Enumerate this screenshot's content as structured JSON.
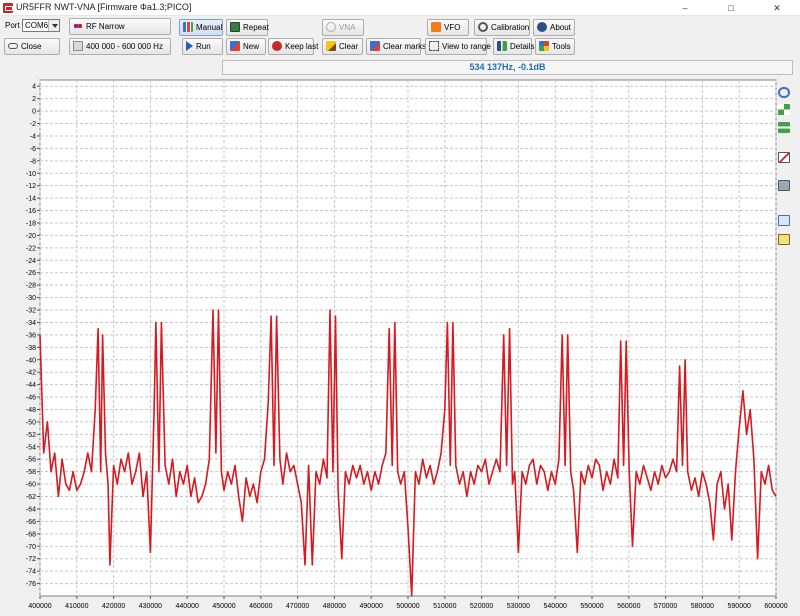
{
  "window": {
    "title": "UR5FFR NWT-VNA [Firmware Фа1.3;PICO]",
    "minimize": "–",
    "maximize": "□",
    "close": "✕"
  },
  "toolbar": {
    "port_label": "Port",
    "port_value": "COM6",
    "close_label": "Close",
    "mode_label": "RF Narrow",
    "range_label": "400 000 - 600 000 Hz",
    "manual_label": "Manual",
    "repeat_label": "Repeat",
    "run_label": "Run",
    "new_label": "New",
    "keep_last_label": "Keep last",
    "clear_label": "Clear",
    "clear_marks_label": "Clear marks",
    "vna_label": "VNA",
    "view_to_range_label": "View to range",
    "vfo_label": "VFO",
    "calibration_label": "Calibration",
    "about_label": "About",
    "details_label": "Details",
    "tools_label": "Tools"
  },
  "status": {
    "readout": "534 137Hz, -0.1dB"
  },
  "side_tools": [
    "zoom-icon",
    "fit-icon",
    "vertical-scale-icon",
    "chart-settings-icon",
    "display-icon",
    "copy-icon",
    "export-icon"
  ],
  "colors": {
    "trace": "#d71920",
    "grid": "#c8c8c8",
    "readout": "#1f6fb0"
  },
  "chart_data": {
    "type": "line",
    "title": "",
    "xlabel": "",
    "ylabel": "",
    "xlim": [
      400000,
      600000
    ],
    "ylim": [
      -78,
      5
    ],
    "x_ticks": [
      400000,
      410000,
      420000,
      430000,
      440000,
      450000,
      460000,
      470000,
      480000,
      490000,
      500000,
      510000,
      520000,
      530000,
      540000,
      550000,
      560000,
      570000,
      580000,
      590000,
      600000
    ],
    "y_ticks": [
      4,
      2,
      0,
      -2,
      -4,
      -6,
      -8,
      -10,
      -12,
      -14,
      -16,
      -18,
      -20,
      -22,
      -24,
      -26,
      -28,
      -30,
      -32,
      -34,
      -36,
      -38,
      -40,
      -42,
      -44,
      -46,
      -48,
      -50,
      -52,
      -54,
      -56,
      -58,
      -60,
      -62,
      -64,
      -66,
      -68,
      -70,
      -72,
      -74,
      -76
    ],
    "grid": true,
    "series": [
      {
        "values": [
          [
            400000,
            -36
          ],
          [
            401000,
            -55
          ],
          [
            402000,
            -50
          ],
          [
            403000,
            -58
          ],
          [
            404000,
            -55
          ],
          [
            405000,
            -62
          ],
          [
            406000,
            -56
          ],
          [
            407000,
            -60
          ],
          [
            408000,
            -61
          ],
          [
            409000,
            -58
          ],
          [
            410000,
            -61
          ],
          [
            411000,
            -60
          ],
          [
            412000,
            -58
          ],
          [
            413000,
            -55
          ],
          [
            414000,
            -58
          ],
          [
            415000,
            -48
          ],
          [
            415800,
            -35
          ],
          [
            416500,
            -58
          ],
          [
            417000,
            -36
          ],
          [
            417800,
            -55
          ],
          [
            418500,
            -60
          ],
          [
            419000,
            -73
          ],
          [
            420000,
            -57
          ],
          [
            421000,
            -60
          ],
          [
            422000,
            -56
          ],
          [
            423000,
            -58
          ],
          [
            424000,
            -55
          ],
          [
            425000,
            -60
          ],
          [
            426000,
            -58
          ],
          [
            427000,
            -55
          ],
          [
            428000,
            -62
          ],
          [
            429000,
            -58
          ],
          [
            430000,
            -71
          ],
          [
            431000,
            -48
          ],
          [
            431500,
            -34
          ],
          [
            432300,
            -58
          ],
          [
            433000,
            -34
          ],
          [
            434000,
            -57
          ],
          [
            435000,
            -60
          ],
          [
            436000,
            -56
          ],
          [
            437000,
            -62
          ],
          [
            438000,
            -58
          ],
          [
            439000,
            -60
          ],
          [
            440000,
            -57
          ],
          [
            441000,
            -62
          ],
          [
            442000,
            -59
          ],
          [
            443000,
            -63
          ],
          [
            444000,
            -62
          ],
          [
            445000,
            -60
          ],
          [
            446000,
            -56
          ],
          [
            447000,
            -32
          ],
          [
            447800,
            -55
          ],
          [
            448500,
            -32
          ],
          [
            449300,
            -58
          ],
          [
            450000,
            -61
          ],
          [
            451000,
            -58
          ],
          [
            452000,
            -60
          ],
          [
            453000,
            -57
          ],
          [
            454000,
            -62
          ],
          [
            455000,
            -66
          ],
          [
            456000,
            -59
          ],
          [
            457000,
            -62
          ],
          [
            458000,
            -60
          ],
          [
            459000,
            -63
          ],
          [
            460000,
            -58
          ],
          [
            461000,
            -56
          ],
          [
            462000,
            -47
          ],
          [
            462800,
            -33
          ],
          [
            463600,
            -57
          ],
          [
            464300,
            -33
          ],
          [
            465200,
            -56
          ],
          [
            466000,
            -60
          ],
          [
            467000,
            -55
          ],
          [
            468000,
            -58
          ],
          [
            469000,
            -57
          ],
          [
            470000,
            -60
          ],
          [
            471000,
            -63
          ],
          [
            472000,
            -73
          ],
          [
            473000,
            -57
          ],
          [
            474000,
            -73
          ],
          [
            475000,
            -58
          ],
          [
            476000,
            -60
          ],
          [
            477000,
            -56
          ],
          [
            478000,
            -59
          ],
          [
            478800,
            -32
          ],
          [
            479600,
            -58
          ],
          [
            480300,
            -33
          ],
          [
            481000,
            -61
          ],
          [
            482000,
            -72
          ],
          [
            483000,
            -58
          ],
          [
            484000,
            -60
          ],
          [
            485000,
            -57
          ],
          [
            486000,
            -59
          ],
          [
            487000,
            -57
          ],
          [
            488000,
            -60
          ],
          [
            489000,
            -58
          ],
          [
            490000,
            -61
          ],
          [
            491000,
            -58
          ],
          [
            492000,
            -60
          ],
          [
            493000,
            -57
          ],
          [
            494000,
            -55
          ],
          [
            494900,
            -35
          ],
          [
            495700,
            -57
          ],
          [
            496400,
            -34
          ],
          [
            497200,
            -58
          ],
          [
            498000,
            -60
          ],
          [
            499000,
            -58
          ],
          [
            500000,
            -67
          ],
          [
            501000,
            -78
          ],
          [
            502000,
            -58
          ],
          [
            503000,
            -60
          ],
          [
            504000,
            -56
          ],
          [
            505000,
            -59
          ],
          [
            506000,
            -57
          ],
          [
            507000,
            -60
          ],
          [
            508000,
            -58
          ],
          [
            509000,
            -55
          ],
          [
            510000,
            -48
          ],
          [
            510700,
            -34
          ],
          [
            511500,
            -57
          ],
          [
            512200,
            -34
          ],
          [
            513000,
            -57
          ],
          [
            514000,
            -60
          ],
          [
            515000,
            -58
          ],
          [
            516000,
            -62
          ],
          [
            517000,
            -58
          ],
          [
            518000,
            -60
          ],
          [
            519000,
            -57
          ],
          [
            520000,
            -58
          ],
          [
            521000,
            -56
          ],
          [
            522000,
            -60
          ],
          [
            523000,
            -58
          ],
          [
            524000,
            -56
          ],
          [
            525000,
            -58
          ],
          [
            526000,
            -36
          ],
          [
            526800,
            -57
          ],
          [
            527600,
            -35
          ],
          [
            528400,
            -60
          ],
          [
            529000,
            -58
          ],
          [
            530000,
            -71
          ],
          [
            531000,
            -58
          ],
          [
            532000,
            -60
          ],
          [
            533000,
            -57
          ],
          [
            534000,
            -56
          ],
          [
            535000,
            -60
          ],
          [
            536000,
            -57
          ],
          [
            537000,
            -58
          ],
          [
            538000,
            -61
          ],
          [
            539000,
            -58
          ],
          [
            540000,
            -60
          ],
          [
            541000,
            -56
          ],
          [
            541900,
            -36
          ],
          [
            542700,
            -57
          ],
          [
            543400,
            -36
          ],
          [
            544200,
            -58
          ],
          [
            545000,
            -61
          ],
          [
            546000,
            -71
          ],
          [
            547000,
            -58
          ],
          [
            548000,
            -60
          ],
          [
            549000,
            -57
          ],
          [
            550000,
            -59
          ],
          [
            551000,
            -56
          ],
          [
            552000,
            -57
          ],
          [
            553000,
            -61
          ],
          [
            554000,
            -58
          ],
          [
            555000,
            -60
          ],
          [
            556000,
            -56
          ],
          [
            557000,
            -59
          ],
          [
            557800,
            -37
          ],
          [
            558600,
            -57
          ],
          [
            559300,
            -37
          ],
          [
            560100,
            -58
          ],
          [
            561000,
            -70
          ],
          [
            562000,
            -58
          ],
          [
            563000,
            -60
          ],
          [
            564000,
            -57
          ],
          [
            565000,
            -59
          ],
          [
            566000,
            -61
          ],
          [
            567000,
            -58
          ],
          [
            568000,
            -60
          ],
          [
            569000,
            -57
          ],
          [
            570000,
            -59
          ],
          [
            571000,
            -58
          ],
          [
            572000,
            -56
          ],
          [
            573000,
            -58
          ],
          [
            573800,
            -41
          ],
          [
            574600,
            -57
          ],
          [
            575300,
            -40
          ],
          [
            576000,
            -58
          ],
          [
            577000,
            -61
          ],
          [
            578000,
            -59
          ],
          [
            579000,
            -62
          ],
          [
            580000,
            -58
          ],
          [
            581000,
            -60
          ],
          [
            582000,
            -63
          ],
          [
            583000,
            -69
          ],
          [
            584000,
            -60
          ],
          [
            585000,
            -58
          ],
          [
            586000,
            -64
          ],
          [
            587000,
            -60
          ],
          [
            588000,
            -69
          ],
          [
            589000,
            -58
          ],
          [
            590000,
            -51
          ],
          [
            591000,
            -45
          ],
          [
            592000,
            -52
          ],
          [
            593000,
            -48
          ],
          [
            594000,
            -56
          ],
          [
            595000,
            -72
          ],
          [
            596000,
            -58
          ],
          [
            597000,
            -60
          ],
          [
            598000,
            -57
          ],
          [
            599000,
            -61
          ],
          [
            600000,
            -62
          ]
        ]
      }
    ]
  }
}
